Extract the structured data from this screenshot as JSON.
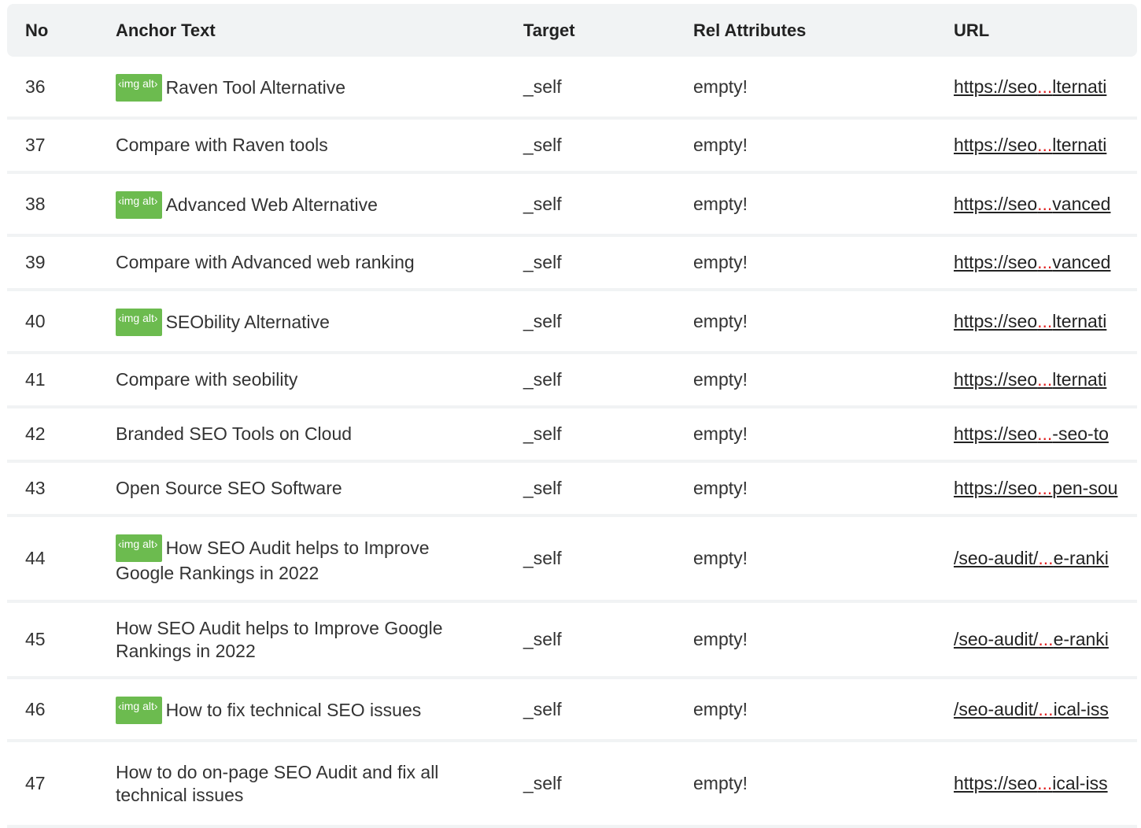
{
  "header": {
    "no": "No",
    "anchor_text": "Anchor Text",
    "target": "Target",
    "rel": "Rel Attributes",
    "url": "URL"
  },
  "img_badge_label": "‹img alt›",
  "ellipsis": "...",
  "rows": [
    {
      "no": "36",
      "img": true,
      "anchor": "Raven Tool Alternative",
      "target": "_self",
      "rel": "empty!",
      "url_start": "https://seo",
      "url_end": "lternati"
    },
    {
      "no": "37",
      "img": false,
      "anchor": "Compare with Raven tools",
      "target": "_self",
      "rel": "empty!",
      "url_start": "https://seo",
      "url_end": "lternati"
    },
    {
      "no": "38",
      "img": true,
      "anchor": "Advanced Web Alternative",
      "target": "_self",
      "rel": "empty!",
      "url_start": "https://seo",
      "url_end": "vanced"
    },
    {
      "no": "39",
      "img": false,
      "anchor": "Compare with Advanced web ranking",
      "target": "_self",
      "rel": "empty!",
      "url_start": "https://seo",
      "url_end": "vanced"
    },
    {
      "no": "40",
      "img": true,
      "anchor": "SEObility Alternative",
      "target": "_self",
      "rel": "empty!",
      "url_start": "https://seo",
      "url_end": "lternati"
    },
    {
      "no": "41",
      "img": false,
      "anchor": "Compare with seobility",
      "target": "_self",
      "rel": "empty!",
      "url_start": "https://seo",
      "url_end": "lternati"
    },
    {
      "no": "42",
      "img": false,
      "anchor": "Branded SEO Tools on Cloud",
      "target": "_self",
      "rel": "empty!",
      "url_start": "https://seo",
      "url_end": "-seo-to"
    },
    {
      "no": "43",
      "img": false,
      "anchor": "Open Source SEO Software",
      "target": "_self",
      "rel": "empty!",
      "url_start": "https://seo",
      "url_end": "pen-sou"
    },
    {
      "no": "44",
      "img": true,
      "anchor": "How SEO Audit helps to Improve Google Rankings in 2022",
      "target": "_self",
      "rel": "empty!",
      "url_start": "/seo-audit/",
      "url_end": "e-ranki"
    },
    {
      "no": "45",
      "img": false,
      "anchor": "How SEO Audit helps to Improve Google Rankings in 2022",
      "target": "_self",
      "rel": "empty!",
      "url_start": "/seo-audit/",
      "url_end": "e-ranki"
    },
    {
      "no": "46",
      "img": true,
      "anchor": "How to fix technical SEO issues",
      "target": "_self",
      "rel": "empty!",
      "url_start": "/seo-audit/",
      "url_end": "ical-iss"
    },
    {
      "no": "47",
      "img": false,
      "anchor": "How to do on-page SEO Audit and fix all technical issues",
      "target": "_self",
      "rel": "empty!",
      "url_start": "https://seo",
      "url_end": "ical-iss"
    }
  ]
}
